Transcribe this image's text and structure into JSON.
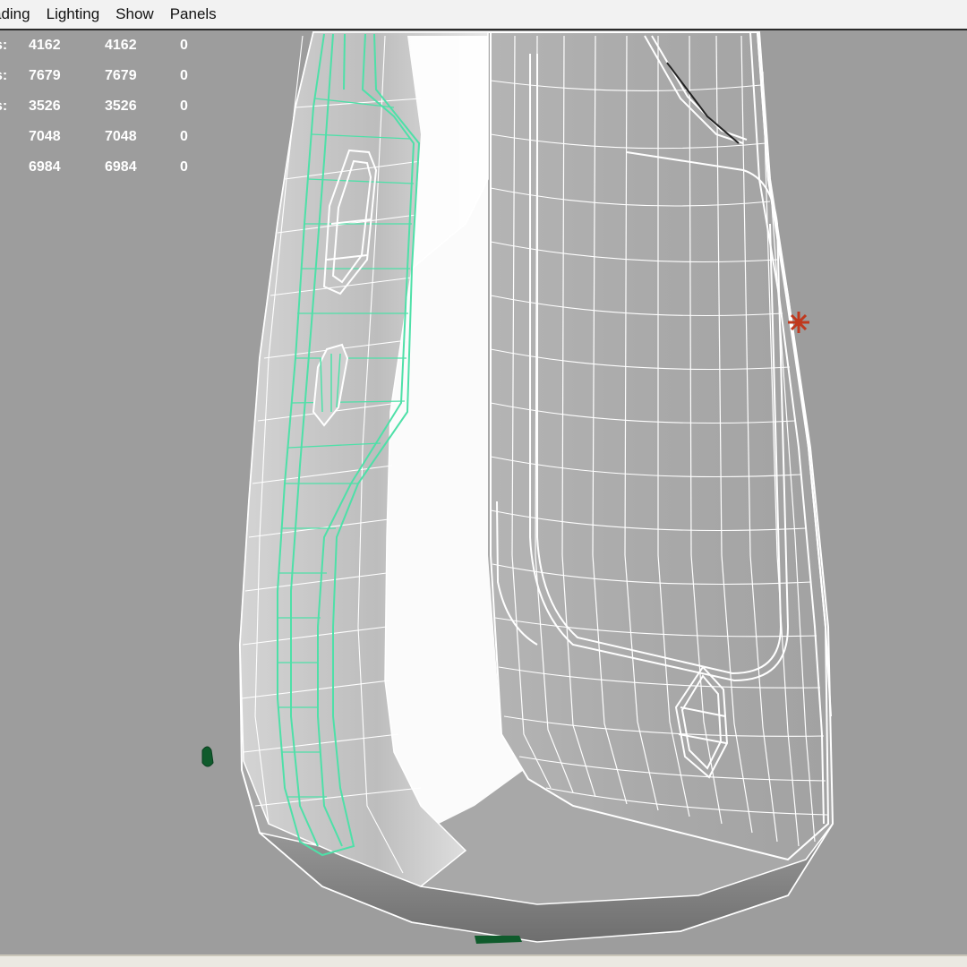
{
  "menubar": {
    "items": [
      "ading",
      "Lighting",
      "Show",
      "Panels"
    ]
  },
  "hud": {
    "rows": [
      {
        "label": "s:",
        "a": "4162",
        "b": "4162",
        "c": "0"
      },
      {
        "label": "s:",
        "a": "7679",
        "b": "7679",
        "c": "0"
      },
      {
        "label": "s:",
        "a": "3526",
        "b": "3526",
        "c": "0"
      },
      {
        "label": "",
        "a": "7048",
        "b": "7048",
        "c": "0"
      },
      {
        "label": "",
        "a": "6984",
        "b": "6984",
        "c": "0"
      }
    ]
  },
  "colors": {
    "viewport_bg": "#9d9d9d",
    "wire": "#ffffff",
    "selection_wire": "#4ee0a8",
    "light_marker": "#c0391e",
    "pivot_marker": "#0f5b2c"
  }
}
